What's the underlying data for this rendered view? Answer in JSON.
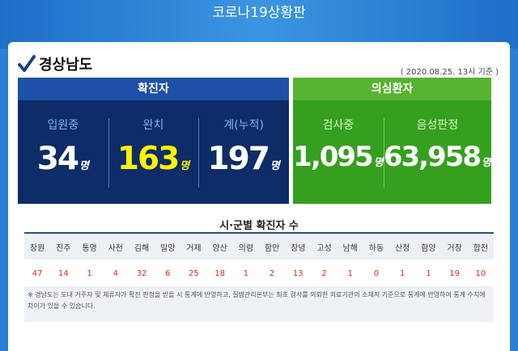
{
  "header": {
    "title": "코로나19상황판"
  },
  "region": {
    "name": "경상남도",
    "date": "( 2020.08.25. 13시 기준 )"
  },
  "confirmed": {
    "title": "확진자",
    "items": [
      {
        "label": "입원중",
        "value": "34",
        "unit": "명"
      },
      {
        "label": "완치",
        "value": "163",
        "unit": "명"
      },
      {
        "label": "계(누적)",
        "value": "197",
        "unit": "명"
      }
    ]
  },
  "suspected": {
    "title": "의심환자",
    "items": [
      {
        "label": "검사중",
        "value": "1,095",
        "unit": "명"
      },
      {
        "label": "음성판정",
        "value": "63,958",
        "unit": "명"
      }
    ]
  },
  "city_table": {
    "title": "시·군별 확진자 수",
    "headers": [
      "창원",
      "진주",
      "통영",
      "사천",
      "김해",
      "밀양",
      "거제",
      "양산",
      "의령",
      "함안",
      "창녕",
      "고성",
      "남해",
      "하동",
      "산청",
      "함양",
      "거창",
      "합천"
    ],
    "values": [
      "47",
      "14",
      "1",
      "4",
      "32",
      "6",
      "25",
      "18",
      "1",
      "2",
      "13",
      "2",
      "1",
      "0",
      "1",
      "1",
      "19",
      "10"
    ]
  },
  "note": "※ 경남도는 도내 거주자 및 체류자가 확진 판정을 받을 시 통계에 반영하고, 질병관리본부는 최초 검사를 의뢰한 의료기관의 소재지 기준으로 통계에 반영하여 통계 수치에 차이가 있을 수 있습니다.",
  "colors": {
    "blue_box": "#0d2c68",
    "green_box": "#35a01e",
    "highlight": "#fff200",
    "city_value": "#d9242b"
  }
}
